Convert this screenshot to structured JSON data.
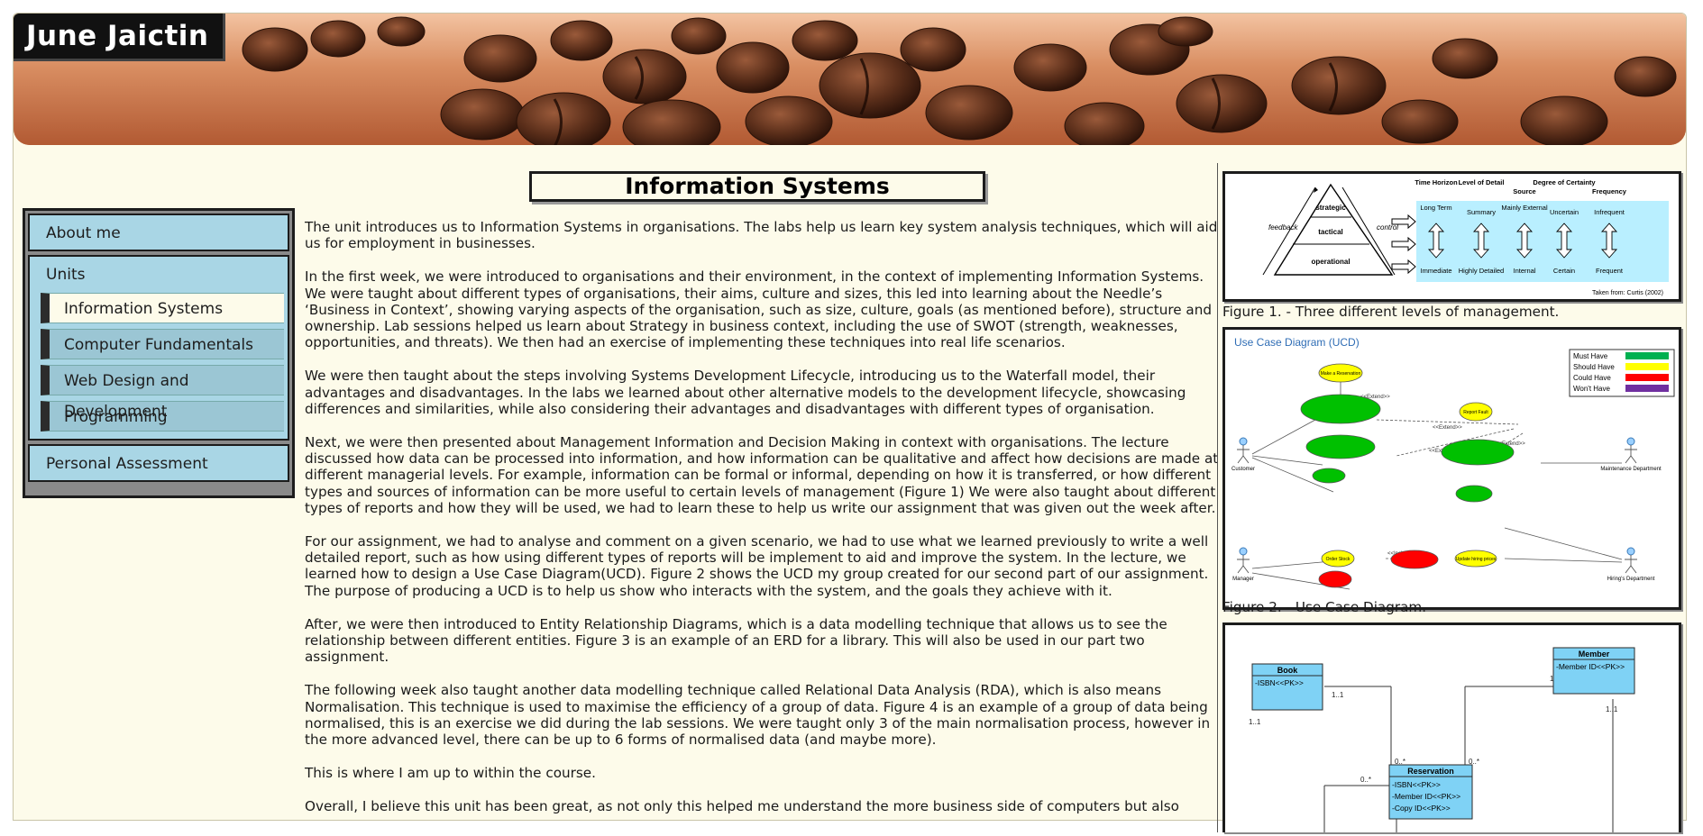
{
  "site": {
    "title": "June Jaictin"
  },
  "nav": {
    "about": "About me",
    "units_head": "Units",
    "units": [
      "Information Systems",
      "Computer Fundamentals",
      "Web Design and Development",
      "Programming"
    ],
    "assessment": "Personal Assessment"
  },
  "main": {
    "title": "Information Systems",
    "paragraphs": [
      "The unit introduces us to Information Systems in organisations. The labs help us learn key system analysis techniques, which will aid us for employment in businesses.",
      "In the first week, we were introduced to organisations and their environment, in the context of implementing Information Systems. We were taught about different types of organisations, their aims, culture and sizes, this led into learning about the Needle’s ‘Business in Context’, showing varying aspects of the organisation, such as size, culture, goals (as mentioned before), structure and ownership. Lab sessions helped us learn about Strategy in business context, including the use of SWOT (strength, weaknesses, opportunities, and threats). We then had an exercise of implementing these techniques into real life scenarios.",
      "We were then taught about the steps involving Systems Development Lifecycle, introducing us to the Waterfall model, their advantages and disadvantages. In the labs we learned about other alternative models to the development lifecycle, showcasing differences and similarities, while also considering their advantages and disadvantages with different types of organisation.",
      "Next, we were then presented about Management Information and Decision Making in context with organisations. The lecture discussed how data can be processed into information, and how information can be qualitative and affect how decisions are made at different managerial levels. For example, information can be formal or informal, depending on how it is transferred, or how different types and sources of information can be more useful to certain levels of management (Figure 1) We were also taught about different types of reports and how they will be used, we had to learn these to help us write our assignment that was given out the week after.",
      "For our assignment, we had to analyse and comment on a given scenario, we had to use what we learned previously to write a well detailed report, such as how using different types of reports will be implement to aid and improve the system. In the lecture, we learned how to design a Use Case Diagram(UCD). Figure 2 shows the UCD my group created for our second part of our assignment. The purpose of producing a UCD is to help us show who interacts with the system, and the goals they achieve with it.",
      "After, we were then introduced to Entity Relationship Diagrams, which is a data modelling technique that allows us to see the relationship between different entities. Figure 3 is an example of an ERD for a library. This will also be used in our part two assignment.",
      "The following week also taught another data modelling technique called Relational Data Analysis (RDA), which is also means Normalisation. This technique is used to maximise the efficiency of a group of data. Figure 4 is an example of a group of data being normalised, this is an exercise we did during the lab sessions. We were taught only 3 of the main normalisation process, however in the more advanced level, there can be up to 6 forms of normalised data (and maybe more).",
      "This is where I am up to within the course.",
      "Overall, I believe this unit has been great, as not only this helped me understand the more business side of computers but also"
    ]
  },
  "figures": {
    "fig1": {
      "caption": "Figure 1. - Three different levels of management.",
      "levels": [
        "strategic",
        "tactical",
        "operational"
      ],
      "side_left": "feedback",
      "side_right": "control",
      "headers": [
        "Time Horizon",
        "Level of Detail",
        "Source",
        "Degree of Certainty",
        "Frequency"
      ],
      "top_row": [
        "Long Term",
        "Summary",
        "Mainly External",
        "Uncertain",
        "Infrequent"
      ],
      "bottom_row": [
        "Immediate",
        "Highly Detailed",
        "Internal",
        "Certain",
        "Frequent"
      ],
      "source": "Taken from: Curtis (2002)"
    },
    "fig2": {
      "caption": "Figure 2. - Use Case Diagram.",
      "title": "Use Case Diagram (UCD)",
      "legend": [
        {
          "label": "Must Have",
          "color": "#00b050"
        },
        {
          "label": "Should Have",
          "color": "#ffff00"
        },
        {
          "label": "Could Have",
          "color": "#ff0000"
        },
        {
          "label": "Won't Have",
          "color": "#7030a0"
        }
      ],
      "actors": [
        "Customer",
        "Manager",
        "Maintenance Department",
        "Hiring's Department"
      ],
      "use_cases": [
        "Make a Reservation",
        "Report Fault",
        "Order Stock",
        "Update hiring prices"
      ],
      "relations": [
        "<<Extend>>",
        "<<Include>>"
      ]
    },
    "fig3": {
      "entities": [
        {
          "name": "Book",
          "fields": [
            "-ISBN<<PK>>"
          ]
        },
        {
          "name": "Member",
          "fields": [
            "-Member ID<<PK>>"
          ]
        },
        {
          "name": "Reservation",
          "fields": [
            "-ISBN<<PK>>",
            "-Member ID<<PK>>",
            "-Copy ID<<PK>>"
          ]
        }
      ],
      "multiplicities": [
        "1..1",
        "1..1",
        "1..1",
        "1..1",
        "0..*",
        "0..*",
        "0..*"
      ]
    }
  },
  "colors": {
    "page_bg": "#fdfbea",
    "nav_bg": "#a9d6e5",
    "border": "#1c1c1c"
  }
}
